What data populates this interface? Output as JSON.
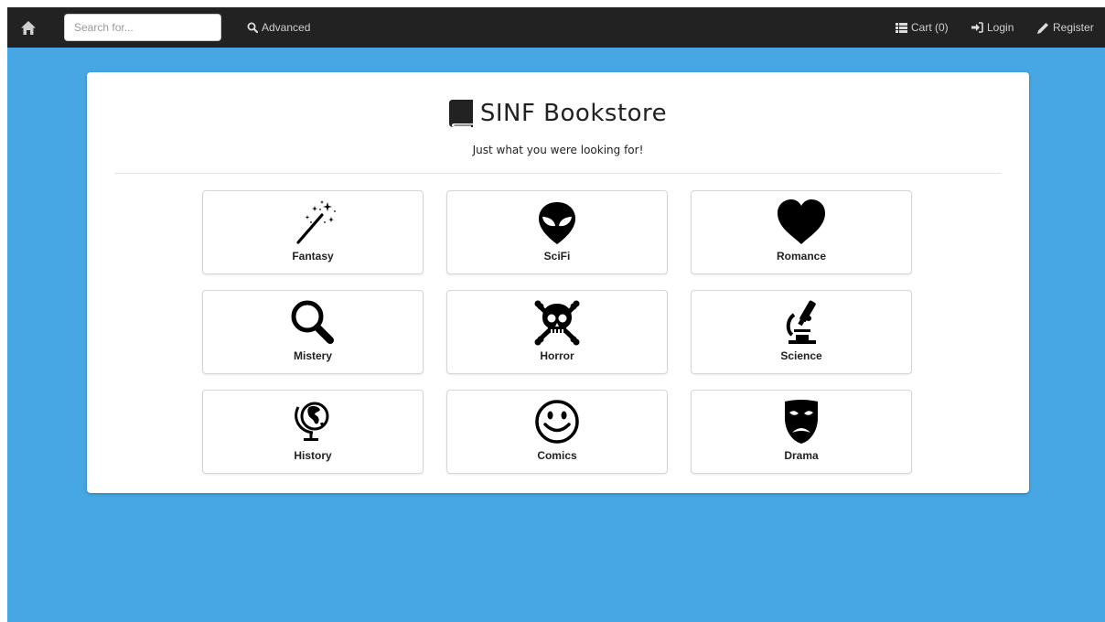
{
  "navbar": {
    "search_placeholder": "Search for...",
    "advanced_label": "Advanced",
    "cart_label": "Cart (0)",
    "login_label": "Login",
    "register_label": "Register"
  },
  "header": {
    "title": "SINF Bookstore",
    "subtitle": "Just what you were looking for!"
  },
  "categories": [
    {
      "label": "Fantasy",
      "icon": "magic-wand-icon"
    },
    {
      "label": "SciFi",
      "icon": "alien-icon"
    },
    {
      "label": "Romance",
      "icon": "heart-icon"
    },
    {
      "label": "Mistery",
      "icon": "magnifier-icon"
    },
    {
      "label": "Horror",
      "icon": "skull-crossbones-icon"
    },
    {
      "label": "Science",
      "icon": "microscope-icon"
    },
    {
      "label": "History",
      "icon": "globe-icon"
    },
    {
      "label": "Comics",
      "icon": "smiley-icon"
    },
    {
      "label": "Drama",
      "icon": "sad-mask-icon"
    }
  ],
  "colors": {
    "navbar_bg": "#222222",
    "page_bg": "#47a6e4",
    "panel_bg": "#ffffff"
  }
}
